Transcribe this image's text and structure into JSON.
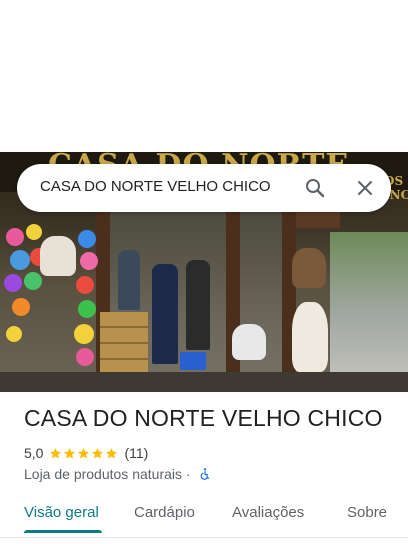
{
  "hero": {
    "image_name": "storefront-photo",
    "sign_text": "CASA DO NORTE",
    "side_sign_text": "OS\nINC"
  },
  "search": {
    "query": "CASA DO NORTE VELHO CHICO",
    "search_icon": "search-icon",
    "clear_icon": "close-icon"
  },
  "place": {
    "title": "CASA DO NORTE VELHO CHICO",
    "rating": "5,0",
    "stars": 5,
    "review_count": "(11)",
    "category": "Loja de produtos naturais",
    "separator": " · ",
    "accessibility_icon": "wheelchair-icon"
  },
  "tabs": [
    {
      "label": "Visão geral",
      "active": true
    },
    {
      "label": "Cardápio",
      "active": false
    },
    {
      "label": "Avaliações",
      "active": false
    },
    {
      "label": "Sobre",
      "active": false
    }
  ],
  "colors": {
    "accent": "#0f7a83",
    "star": "#fbbc04",
    "text": "#202124",
    "secondary_text": "#5f6368"
  }
}
